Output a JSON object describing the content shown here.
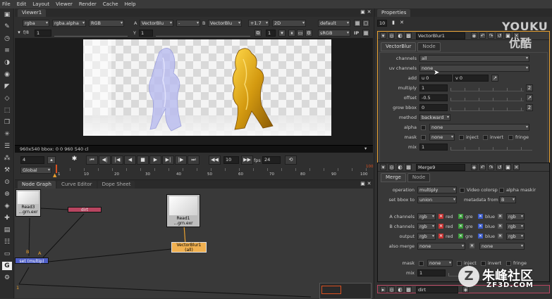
{
  "menu": [
    "File",
    "Edit",
    "Layout",
    "Viewer",
    "Render",
    "Cache",
    "Help"
  ],
  "viewer": {
    "tab": "Viewer1",
    "channels": "rgba",
    "alpha_channel": "rgba.alpha",
    "display": "RGB",
    "a_label": "A",
    "a_input": "VectorBlu",
    "a_op": "-",
    "b_label": "B",
    "b_input": "VectorBlu",
    "gain": "+1.7",
    "view_mode": "2D",
    "lut": "default",
    "frame_field": "1",
    "fstop": "f/8",
    "frame_y": "1",
    "gamma_y": "1",
    "zoom_y": "Y",
    "proxy": "1",
    "colorspace": "sRGB",
    "roi_label": "IP",
    "info_bar": "960x540 bbox: 0 0 960 540 cl"
  },
  "timeline": {
    "frame": "4",
    "step_frames": "10",
    "fps_label": "fps",
    "fps_value": "24",
    "scope": "Global",
    "ticks": [
      "1",
      "10",
      "20",
      "30",
      "40",
      "50",
      "60",
      "70",
      "80",
      "90",
      "100"
    ],
    "end_marker": "100"
  },
  "node_graph": {
    "tabs": [
      "Node Graph",
      "Curve Editor",
      "Dope Sheet"
    ],
    "read3_label": "Read3",
    "read3_file": "...grn.exr",
    "dirt_label": "dirt",
    "read1_label": "Read1",
    "read1_file": "...grn.exr",
    "vectorblur_label": "VectorBlur1",
    "vectorblur_sub": "(all)",
    "merge_label": "set (multip)",
    "input_b": "B",
    "input_a": "A",
    "frame_marker": "1"
  },
  "properties": {
    "tab": "Properties",
    "max_panels": "10",
    "vectorblur": {
      "name": "VectorBlur1",
      "tabs": [
        "VectorBlur",
        "Node"
      ],
      "channels_label": "channels",
      "channels_value": "all",
      "uv_label": "uv channels",
      "uv_value": "none",
      "add_label": "add",
      "add_u": "u 0",
      "add_v": "v 0",
      "multiply_label": "multiply",
      "multiply_value": "1",
      "offset_label": "offset",
      "offset_value": "-0.5",
      "growbbox_label": "grow bbox",
      "growbbox_value": "0",
      "method_label": "method",
      "method_value": "backward",
      "alpha_label": "alpha",
      "alpha_value": "none",
      "mask_label": "mask",
      "mask_value": "none",
      "inject_label": "inject",
      "invert_label": "invert",
      "fringe_label": "fringe",
      "mix_label": "mix",
      "mix_value": "1",
      "side_btn": "2"
    },
    "merge": {
      "name": "Merge9",
      "tabs": [
        "Merge",
        "Node"
      ],
      "operation_label": "operation",
      "operation_value": "multiply",
      "video_colorspace": "Video colorsp",
      "alpha_masking": "alpha maskir",
      "setbbox_label": "set bbox to",
      "setbbox_value": "union",
      "metadata_label": "metadata from",
      "metadata_value": "B",
      "a_channels_label": "A channels",
      "b_channels_label": "B channels",
      "output_label": "output",
      "ch_value": "rgb",
      "red": "red",
      "green": "gre",
      "blue": "blue",
      "rgba": "rgb",
      "alsomerge_label": "also merge",
      "alsomerge_value": "none",
      "alsomerge_value2": "none",
      "mask_label": "mask",
      "mask_value": "none",
      "inject_label": "inject",
      "invert_label": "invert",
      "fringe_label": "fringe",
      "mix_label": "mix",
      "mix_value": "1"
    },
    "dirt_name": "dirt"
  },
  "watermarks": {
    "youku_en": "YOUKU",
    "youku_cn": "优酷",
    "site_cn": "朱峰社区",
    "site_url": "ZF3D.COM"
  },
  "colors": {
    "accent_orange": "#e8a030",
    "node_dirt": "#b84560",
    "node_merge": "#5060c8",
    "node_vectorblur": "#f0b050",
    "timeline_marker": "#d95020"
  }
}
